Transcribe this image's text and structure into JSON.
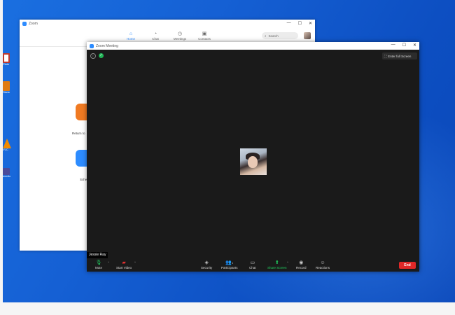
{
  "desktop": {
    "icons": [
      {
        "label": "Plate",
        "color": "#c0392b"
      },
      {
        "label": "Sketc",
        "color": "#e07a10"
      },
      {
        "label": "VLC",
        "color": "#f08a00"
      },
      {
        "label": "mediu",
        "color": "#4a4a9a"
      }
    ]
  },
  "zoom_main": {
    "title": "Zoom",
    "nav": [
      {
        "label": "Home",
        "icon": "home-icon",
        "glyph": "⌂"
      },
      {
        "label": "Chat",
        "icon": "chat-icon",
        "glyph": "◔"
      },
      {
        "label": "Meetings",
        "icon": "clock-icon",
        "glyph": "◷"
      },
      {
        "label": "Contacts",
        "icon": "contacts-icon",
        "glyph": "▣"
      }
    ],
    "search_placeholder": "Search",
    "home_buttons": [
      {
        "label": "Return to",
        "color": "#f07a22"
      },
      {
        "label": "Sche",
        "color": "#2d8cff"
      }
    ],
    "window_controls": [
      "—",
      "☐",
      "✕"
    ]
  },
  "meeting": {
    "title": "Zoom Meeting",
    "fullscreen_label": "Enter full Screen",
    "participant_name": "Jessie Ray",
    "participants_count": "1",
    "toolbar": {
      "mute": "Mute",
      "start_video": "Start Video",
      "security": "Security",
      "participants": "Participants",
      "chat": "Chat",
      "share_screen": "Share Screen",
      "record": "Record",
      "reactions": "Reactions",
      "end": "End"
    },
    "colors": {
      "share": "#20d060",
      "end": "#e02828",
      "secure": "#20b456"
    }
  }
}
